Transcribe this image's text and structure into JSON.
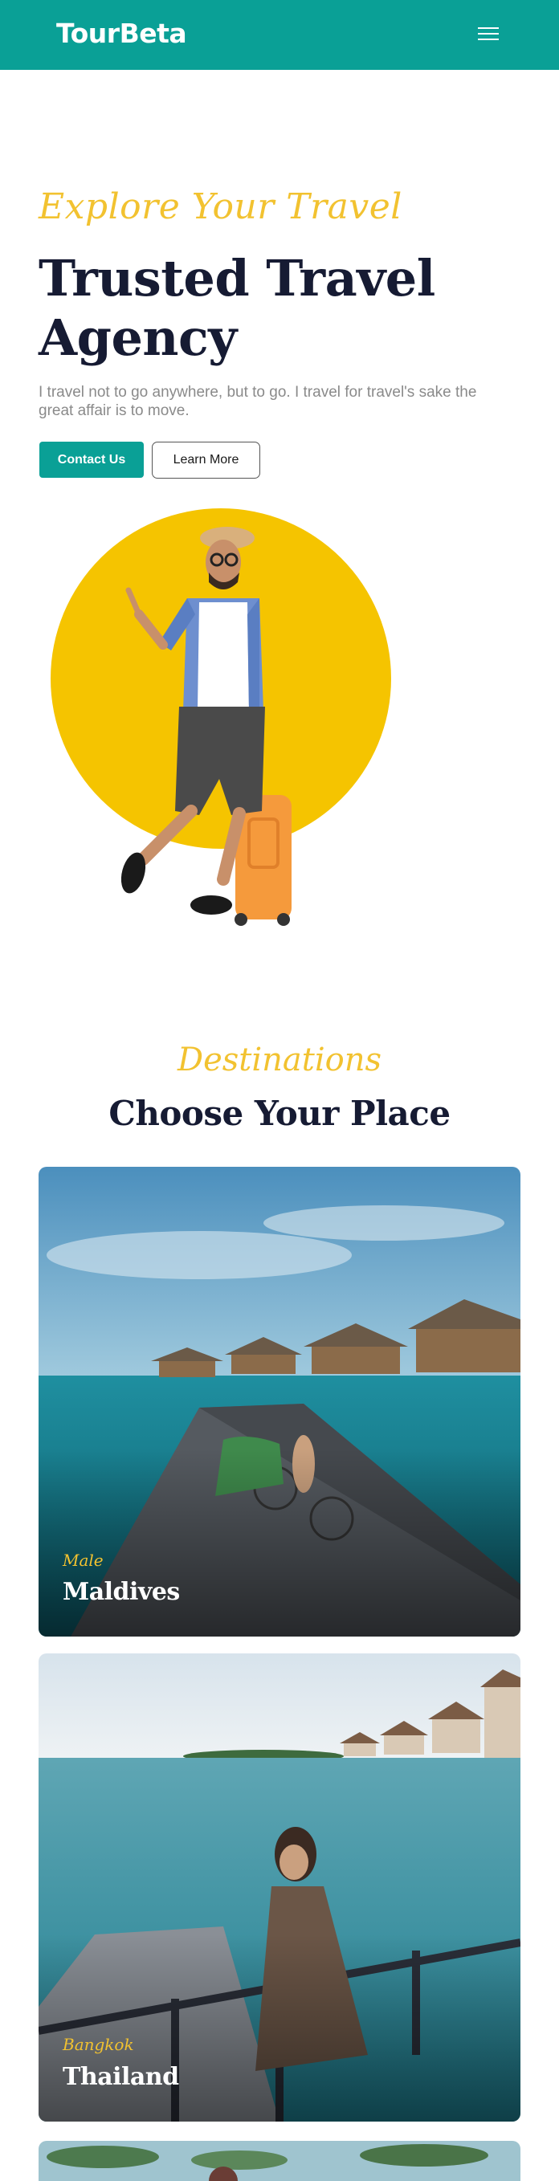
{
  "header": {
    "brand": "TourBeta",
    "menu_icon": "hamburger-menu-icon"
  },
  "hero": {
    "script_title": "Explore Your Travel",
    "title": "Trusted Travel Agency",
    "description": "I travel not to go anywhere, but to go. I travel for travel's sake the great affair is to move.",
    "primary_button": "Contact Us",
    "secondary_button": "Learn More",
    "accent_color": "#f5c400"
  },
  "destinations": {
    "script_title": "Destinations",
    "title": "Choose Your Place",
    "cards": [
      {
        "subtitle": "Male",
        "name": "Maldives"
      },
      {
        "subtitle": "Bangkok",
        "name": "Thailand"
      }
    ]
  },
  "colors": {
    "brand": "#0aa096",
    "accent": "#f2c230",
    "heading": "#161b33"
  }
}
